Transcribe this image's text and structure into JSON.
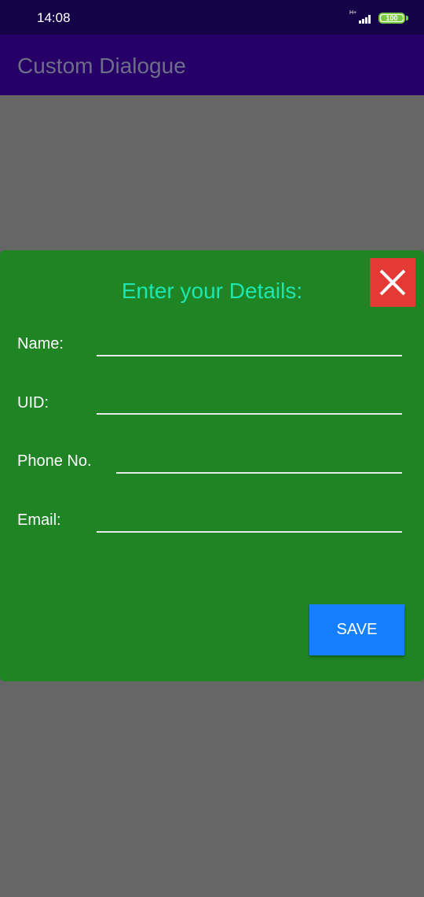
{
  "status_bar": {
    "time": "14:08",
    "network": "H+",
    "battery": "100",
    "icons": [
      "signal-icon",
      "battery-icon"
    ]
  },
  "app_bar": {
    "title": "Custom Dialogue"
  },
  "dialog": {
    "title": "Enter your Details:",
    "close_icon": "close-icon",
    "fields": [
      {
        "label": "Name:",
        "value": ""
      },
      {
        "label": "UID:",
        "value": ""
      },
      {
        "label": "Phone No.",
        "value": ""
      },
      {
        "label": "Email:",
        "value": ""
      }
    ],
    "save_label": "SAVE"
  },
  "colors": {
    "status_bar": "#140447",
    "app_bar": "#260066",
    "dialog_background": "#1f8424",
    "dialog_title": "#1ee6b0",
    "close_button": "#e53935",
    "save_button": "#1580ff",
    "scrim": "#666666"
  }
}
